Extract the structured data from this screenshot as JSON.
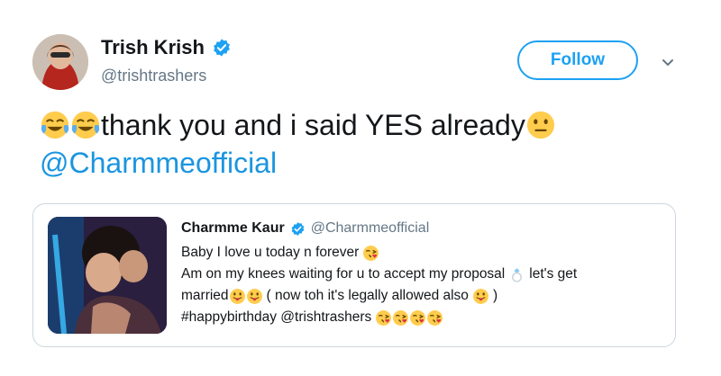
{
  "author": {
    "name": "Trish Krish",
    "handle": "@trishtrashers",
    "verified_icon": "verified-badge-icon"
  },
  "follow_label": "Follow",
  "menu_icon": "chevron-down-icon",
  "tweet": {
    "line1_text": "thank you and i said YES already",
    "mention": "@Charmmeofficial",
    "emojis": [
      "face-with-tears-of-joy",
      "face-with-tears-of-joy",
      "neutral-face"
    ]
  },
  "quoted": {
    "name": "Charmme Kaur",
    "handle": "@Charmmeofficial",
    "line1": "Baby I love u today n forever",
    "line2_a": "Am on my knees waiting for u to accept my proposal",
    "line2_b": "let's get",
    "line3_a": "married",
    "line3_b": "( now toh it's legally allowed also",
    "line3_c": ")",
    "line4": "#happybirthday @trishtrashers"
  },
  "colors": {
    "accent": "#1da1f2",
    "mention": "#1b95e0",
    "secondary_text": "#657786",
    "border": "#ccd6dd"
  }
}
